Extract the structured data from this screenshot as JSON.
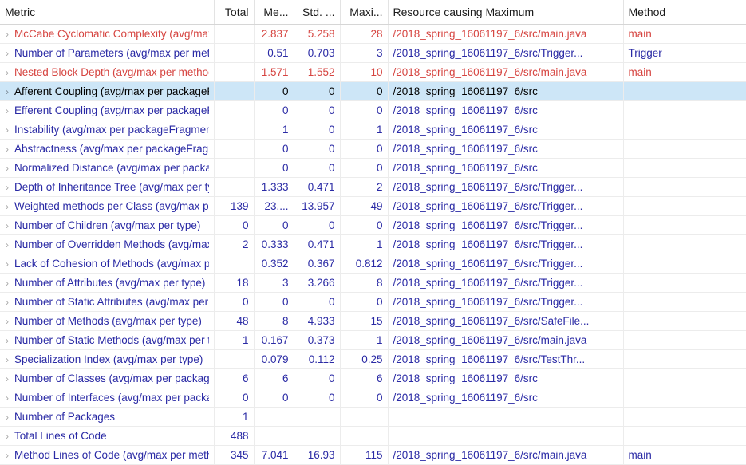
{
  "table": {
    "columns": [
      {
        "key": "metric",
        "label": "Metric",
        "align": "left"
      },
      {
        "key": "total",
        "label": "Total",
        "align": "right"
      },
      {
        "key": "mean",
        "label": "Me...",
        "align": "right"
      },
      {
        "key": "std",
        "label": "Std. ...",
        "align": "right"
      },
      {
        "key": "max",
        "label": "Maxi...",
        "align": "right"
      },
      {
        "key": "resource",
        "label": "Resource causing Maximum",
        "align": "left"
      },
      {
        "key": "method",
        "label": "Method",
        "align": "left"
      }
    ],
    "expand_icon": "›",
    "colors": {
      "red": "#d64541",
      "blue": "#2a2aa5",
      "header_text": "#1b1b1b",
      "selected_row": "#cde6f7",
      "grid_line": "#ececec"
    },
    "rows": [
      {
        "metric": "McCabe Cyclomatic Complexity (avg/max per method)",
        "total": "",
        "mean": "2.837",
        "std": "5.258",
        "max": "28",
        "resource": "/2018_spring_16061197_6/src/main.java",
        "method": "main",
        "severity": "red",
        "selected": false
      },
      {
        "metric": "Number of Parameters (avg/max per method)",
        "total": "",
        "mean": "0.51",
        "std": "0.703",
        "max": "3",
        "resource": "/2018_spring_16061197_6/src/Trigger...",
        "method": "Trigger",
        "severity": "blue",
        "selected": false
      },
      {
        "metric": "Nested Block Depth (avg/max per method)",
        "total": "",
        "mean": "1.571",
        "std": "1.552",
        "max": "10",
        "resource": "/2018_spring_16061197_6/src/main.java",
        "method": "main",
        "severity": "red",
        "selected": false
      },
      {
        "metric": "Afferent Coupling (avg/max per packageFragment)",
        "total": "",
        "mean": "0",
        "std": "0",
        "max": "0",
        "resource": "/2018_spring_16061197_6/src",
        "method": "",
        "severity": "blue",
        "selected": true
      },
      {
        "metric": "Efferent Coupling (avg/max per packageFragment)",
        "total": "",
        "mean": "0",
        "std": "0",
        "max": "0",
        "resource": "/2018_spring_16061197_6/src",
        "method": "",
        "severity": "blue",
        "selected": false
      },
      {
        "metric": "Instability (avg/max per packageFragment)",
        "total": "",
        "mean": "1",
        "std": "0",
        "max": "1",
        "resource": "/2018_spring_16061197_6/src",
        "method": "",
        "severity": "blue",
        "selected": false
      },
      {
        "metric": "Abstractness (avg/max per packageFragment)",
        "total": "",
        "mean": "0",
        "std": "0",
        "max": "0",
        "resource": "/2018_spring_16061197_6/src",
        "method": "",
        "severity": "blue",
        "selected": false
      },
      {
        "metric": "Normalized Distance (avg/max per packageFragment)",
        "total": "",
        "mean": "0",
        "std": "0",
        "max": "0",
        "resource": "/2018_spring_16061197_6/src",
        "method": "",
        "severity": "blue",
        "selected": false
      },
      {
        "metric": "Depth of Inheritance Tree (avg/max per type)",
        "total": "",
        "mean": "1.333",
        "std": "0.471",
        "max": "2",
        "resource": "/2018_spring_16061197_6/src/Trigger...",
        "method": "",
        "severity": "blue",
        "selected": false
      },
      {
        "metric": "Weighted methods per Class (avg/max per type)",
        "total": "139",
        "mean": "23....",
        "std": "13.957",
        "max": "49",
        "resource": "/2018_spring_16061197_6/src/Trigger...",
        "method": "",
        "severity": "blue",
        "selected": false
      },
      {
        "metric": "Number of Children (avg/max per type)",
        "total": "0",
        "mean": "0",
        "std": "0",
        "max": "0",
        "resource": "/2018_spring_16061197_6/src/Trigger...",
        "method": "",
        "severity": "blue",
        "selected": false
      },
      {
        "metric": "Number of Overridden Methods (avg/max per type)",
        "total": "2",
        "mean": "0.333",
        "std": "0.471",
        "max": "1",
        "resource": "/2018_spring_16061197_6/src/Trigger...",
        "method": "",
        "severity": "blue",
        "selected": false
      },
      {
        "metric": "Lack of Cohesion of Methods (avg/max per type)",
        "total": "",
        "mean": "0.352",
        "std": "0.367",
        "max": "0.812",
        "resource": "/2018_spring_16061197_6/src/Trigger...",
        "method": "",
        "severity": "blue",
        "selected": false
      },
      {
        "metric": "Number of Attributes (avg/max per type)",
        "total": "18",
        "mean": "3",
        "std": "3.266",
        "max": "8",
        "resource": "/2018_spring_16061197_6/src/Trigger...",
        "method": "",
        "severity": "blue",
        "selected": false
      },
      {
        "metric": "Number of Static Attributes (avg/max per type)",
        "total": "0",
        "mean": "0",
        "std": "0",
        "max": "0",
        "resource": "/2018_spring_16061197_6/src/Trigger...",
        "method": "",
        "severity": "blue",
        "selected": false
      },
      {
        "metric": "Number of Methods (avg/max per type)",
        "total": "48",
        "mean": "8",
        "std": "4.933",
        "max": "15",
        "resource": "/2018_spring_16061197_6/src/SafeFile...",
        "method": "",
        "severity": "blue",
        "selected": false
      },
      {
        "metric": "Number of Static Methods (avg/max per type)",
        "total": "1",
        "mean": "0.167",
        "std": "0.373",
        "max": "1",
        "resource": "/2018_spring_16061197_6/src/main.java",
        "method": "",
        "severity": "blue",
        "selected": false
      },
      {
        "metric": "Specialization Index (avg/max per type)",
        "total": "",
        "mean": "0.079",
        "std": "0.112",
        "max": "0.25",
        "resource": "/2018_spring_16061197_6/src/TestThr...",
        "method": "",
        "severity": "blue",
        "selected": false
      },
      {
        "metric": "Number of Classes (avg/max per packageFragment)",
        "total": "6",
        "mean": "6",
        "std": "0",
        "max": "6",
        "resource": "/2018_spring_16061197_6/src",
        "method": "",
        "severity": "blue",
        "selected": false
      },
      {
        "metric": "Number of Interfaces (avg/max per packageFragment)",
        "total": "0",
        "mean": "0",
        "std": "0",
        "max": "0",
        "resource": "/2018_spring_16061197_6/src",
        "method": "",
        "severity": "blue",
        "selected": false
      },
      {
        "metric": "Number of Packages",
        "total": "1",
        "mean": "",
        "std": "",
        "max": "",
        "resource": "",
        "method": "",
        "severity": "blue",
        "selected": false
      },
      {
        "metric": "Total Lines of Code",
        "total": "488",
        "mean": "",
        "std": "",
        "max": "",
        "resource": "",
        "method": "",
        "severity": "blue",
        "selected": false
      },
      {
        "metric": "Method Lines of Code (avg/max per method)",
        "total": "345",
        "mean": "7.041",
        "std": "16.93",
        "max": "115",
        "resource": "/2018_spring_16061197_6/src/main.java",
        "method": "main",
        "severity": "blue",
        "selected": false
      }
    ]
  }
}
